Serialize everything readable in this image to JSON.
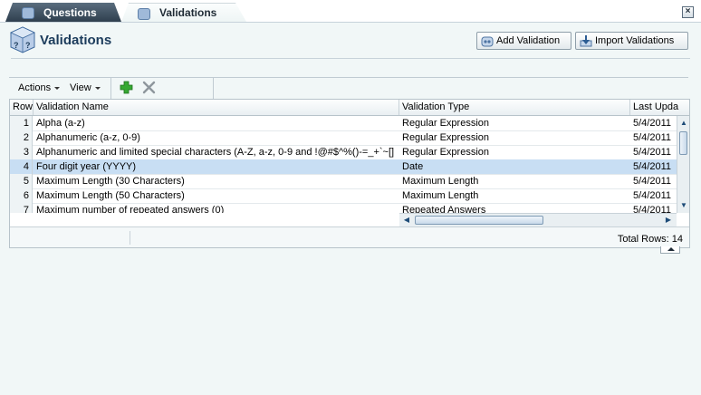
{
  "tabs": [
    {
      "label": "Questions",
      "active": false
    },
    {
      "label": "Validations",
      "active": true
    }
  ],
  "page": {
    "title": "Validations"
  },
  "buttons": {
    "add": "Add Validation",
    "import": "Import Validations"
  },
  "toolbar": {
    "actions": "Actions",
    "view": "View",
    "add_icon": "plus-icon",
    "delete_icon": "delete-x-icon"
  },
  "table": {
    "columns": [
      "Row",
      "Validation Name",
      "Validation Type",
      "Last Upda"
    ],
    "rows": [
      {
        "row": "1",
        "name": "Alpha (a-z)",
        "type": "Regular Expression",
        "updated": "5/4/2011"
      },
      {
        "row": "2",
        "name": "Alphanumeric (a-z, 0-9)",
        "type": "Regular Expression",
        "updated": "5/4/2011"
      },
      {
        "row": "3",
        "name": "Alphanumeric and limited special characters (A-Z, a-z, 0-9 and !@#$^%()-=_+`~[]",
        "type": "Regular Expression",
        "updated": "5/4/2011"
      },
      {
        "row": "4",
        "name": "Four digit year (YYYY)",
        "type": "Date",
        "updated": "5/4/2011"
      },
      {
        "row": "5",
        "name": "Maximum Length (30 Characters)",
        "type": "Maximum Length",
        "updated": "5/4/2011"
      },
      {
        "row": "6",
        "name": "Maximum Length (50 Characters)",
        "type": "Maximum Length",
        "updated": "5/4/2011"
      },
      {
        "row": "7",
        "name": "Maximum number of repeated answers (0)",
        "type": "Repeated Answers",
        "updated": "5/4/2011"
      }
    ],
    "selected_row": 4,
    "total_rows": "Total Rows: 14"
  },
  "colors": {
    "selected_row": "#c8def3",
    "title": "#1c3c5c",
    "tab_dark": "#2f3f4e",
    "add_green": "#2e9a2a"
  }
}
